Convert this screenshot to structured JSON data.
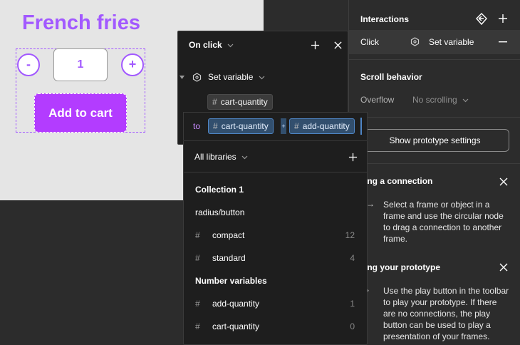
{
  "canvas": {
    "title": "French fries",
    "minus_label": "-",
    "quantity_value": "1",
    "plus_label": "+",
    "add_to_cart_label": "Add to cart"
  },
  "right_panel": {
    "interactions_title": "Interactions",
    "trigger_label": "Click",
    "action_label": "Set variable",
    "scroll_title": "Scroll behavior",
    "overflow_label": "Overflow",
    "overflow_value": "No scrolling",
    "prototype_button": "Show prototype settings",
    "help_connection_title": "reating a connection",
    "help_connection_text": "Select a frame or object in a frame and use the circular node to drag a connection to another frame.",
    "help_prototype_title": "unning your prototype",
    "help_prototype_text": "Use the play button in the toolbar to play your prototype. If there are no connections, the play button can be used to play a presentation of your frames."
  },
  "onclick_panel": {
    "title": "On click",
    "action": "Set variable",
    "target_variable": "cart-quantity",
    "to_label": "to",
    "expr_left": "cart-quantity",
    "operator": "+",
    "expr_right": "add-quantity"
  },
  "libraries_panel": {
    "scope_label": "All libraries",
    "collection_title": "Collection 1",
    "group_title": "radius/button",
    "items": [
      {
        "name": "compact",
        "value": "12"
      },
      {
        "name": "standard",
        "value": "4"
      }
    ],
    "number_section_title": "Number variables",
    "number_items": [
      {
        "name": "add-quantity",
        "value": "1"
      },
      {
        "name": "cart-quantity",
        "value": "0"
      }
    ]
  },
  "colors": {
    "accent": "#a259ff",
    "button": "#b33cff",
    "variable_chip": "#324f6e",
    "panel_bg": "#1e1e1e",
    "ui_bg": "#2c2c2c"
  },
  "icons": [
    "interactions-icon",
    "plus-icon",
    "close-icon",
    "minus-icon",
    "variable-icon",
    "chevron-down-icon",
    "arrow-right-icon",
    "caret-down-icon"
  ]
}
